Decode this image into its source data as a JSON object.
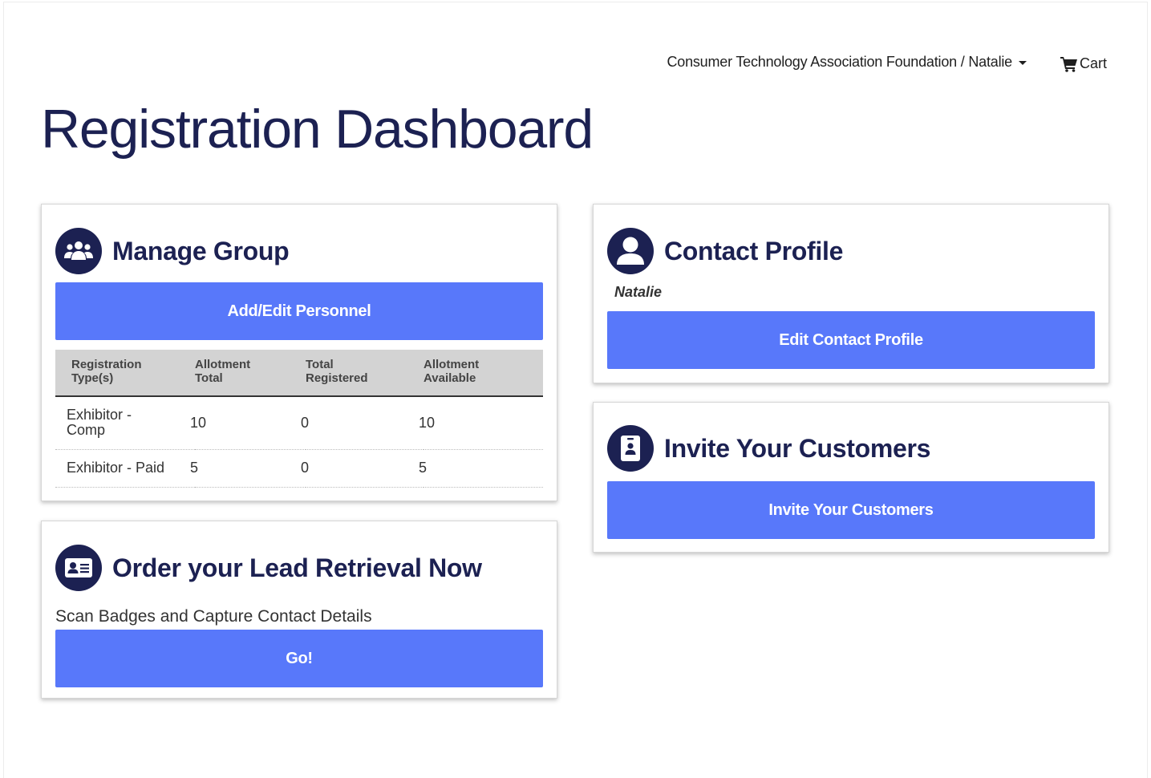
{
  "header": {
    "account_label": "Consumer Technology Association Foundation / Natalie",
    "cart_label": "Cart"
  },
  "page_title": "Registration Dashboard",
  "manage_group": {
    "title": "Manage Group",
    "button_label": "Add/Edit Personnel",
    "table": {
      "headers": [
        [
          "Registration",
          "Type(s)"
        ],
        [
          "Allotment",
          "Total"
        ],
        [
          "Total",
          "Registered"
        ],
        [
          "Allotment",
          "Available"
        ]
      ],
      "rows": [
        {
          "type": "Exhibitor - Comp",
          "allotment_total": "10",
          "total_registered": "0",
          "allotment_available": "10"
        },
        {
          "type": "Exhibitor - Paid",
          "allotment_total": "5",
          "total_registered": "0",
          "allotment_available": "5"
        }
      ]
    }
  },
  "lead_retrieval": {
    "title": "Order your Lead Retrieval Now",
    "subtitle": "Scan Badges and Capture Contact Details",
    "button_label": "Go!"
  },
  "contact_profile": {
    "title": "Contact Profile",
    "name": "Natalie",
    "button_label": "Edit Contact Profile"
  },
  "invite": {
    "title": "Invite Your Customers",
    "button_label": "Invite Your Customers"
  },
  "icons": {
    "manage_group": "users-icon",
    "contact_profile": "user-circle-icon",
    "lead_retrieval": "id-card-icon",
    "invite": "id-badge-icon",
    "cart": "shopping-cart-icon",
    "account": "caret-down-icon"
  },
  "colors": {
    "primary_navy": "#1c2152",
    "button_blue": "#5878fa",
    "table_header_bg": "#d3d3d3"
  }
}
